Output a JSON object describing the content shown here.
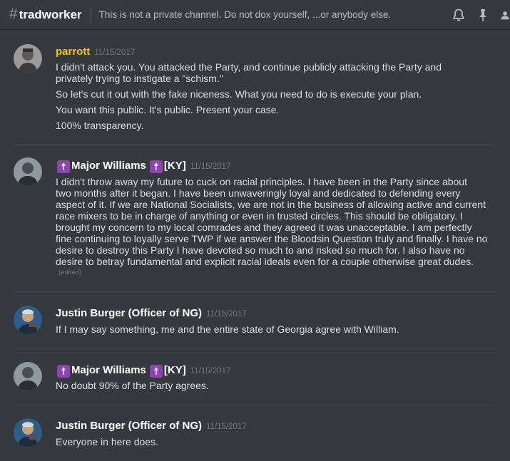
{
  "header": {
    "hash": "#",
    "channel": "tradworker",
    "topic": "This is not a private channel. Do not dox yourself, ...or anybody else."
  },
  "icons": {
    "notifications": "bell-icon",
    "pins": "pin-icon",
    "members": "members-icon"
  },
  "messages": [
    {
      "author": "parrott",
      "timestamp": "11/15/2017",
      "lines": [
        "I didn't attack you. You attacked the Party, and continue publicly attacking the Party and",
        "privately trying to instigate a \"schism.\"",
        "So let's cut it out with the fake niceness. What you need to do is execute your plan.",
        "You want this public. It's public. Present your case.",
        "100% transparency."
      ]
    },
    {
      "author": "Major Williams",
      "author_suffix": "[KY]",
      "timestamp": "11/15/2017",
      "lines": [
        "I didn't throw away my future to cuck on racial principles. I have been in the Party since about",
        "two months after it began. I have been unwaveringly loyal and dedicated to defending every",
        "aspect of it. If we are National Socialists, we are not in the business of allowing active and current",
        "race mixers to be in charge of anything or even in trusted circles. This should be obligatory. I",
        "brought my concern to my local comrades and they agreed it was unacceptable. I am perfectly",
        "fine continuing to loyally serve TWP if we answer the Bloodsin Question truly and finally. I have no",
        "desire to destroy this Party I have devoted so much to and risked so much for. I also have no",
        "desire to betray fundamental and explicit racial ideals even for a couple otherwise great dudes."
      ],
      "edited": "(edited)"
    },
    {
      "author": "Justin Burger (Officer of NG)",
      "timestamp": "11/15/2017",
      "lines": [
        "If I may say something, me and the entire state of Georgia agree with William."
      ]
    },
    {
      "author": "Major Williams",
      "author_suffix": "[KY]",
      "timestamp": "11/15/2017",
      "lines": [
        "No doubt 90% of the Party agrees."
      ]
    },
    {
      "author": "Justin Burger (Officer of NG)",
      "timestamp": "11/15/2017",
      "lines": [
        "Everyone in here does."
      ]
    }
  ],
  "colors": {
    "background": "#36393e",
    "parrott_name": "#f1c40f",
    "cross_emoji": "#8e44ad"
  }
}
